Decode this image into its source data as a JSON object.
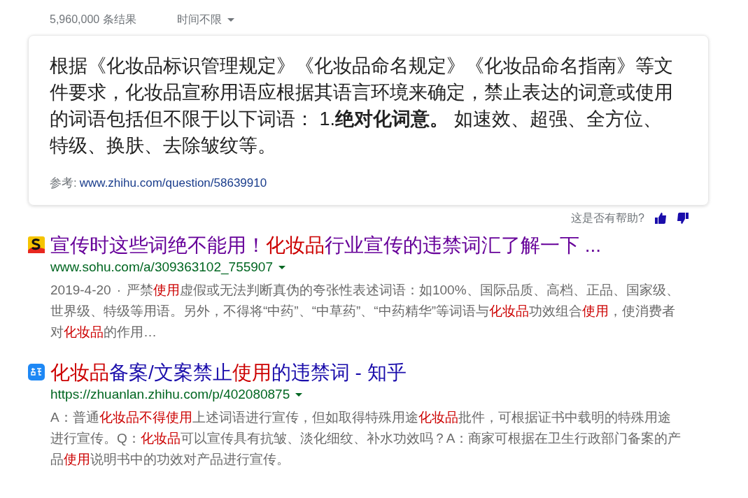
{
  "result_stats": {
    "count": "5,960,000 条结果",
    "time_filter": "时间不限"
  },
  "answer_card": {
    "text": "根据《化妆品标识管理规定》《化妆品命名规定》《化妆品命名指南》等文件要求，化妆品宣称用语应根据其语言环境来确定，禁止表达的词意或使用的词语包括但不限于以下词语： 1.**绝对化词意。** 如速效、超强、全方位、特级、换肤、去除皱纹等。",
    "source_label": "参考:",
    "source_link": "www.zhihu.com/question/58639910"
  },
  "feedback": {
    "question": "这是否有帮助?"
  },
  "results": [
    {
      "kind": "sohu",
      "visited": true,
      "title": [
        {
          "text": "宣传时这些词绝不能用！",
          "highlight": false
        },
        {
          "text": "化妆品",
          "highlight": true
        },
        {
          "text": "行业宣传的违禁词汇了解一下 ...",
          "highlight": false
        }
      ],
      "url": "www.sohu.com/a/309363102_755907",
      "date": "2019-4-20",
      "separator": "·",
      "snippet": [
        {
          "text": "严禁",
          "highlight": false
        },
        {
          "text": "使用",
          "highlight": true
        },
        {
          "text": "虚假或无法判断真伪的夸张性表述词语：如100%、国际品质、高档、正品、国家级、世界级、特级等用语。另外，不得将“中药”、“中草药”、“中药精华”等词语与",
          "highlight": false
        },
        {
          "text": "化妆品",
          "highlight": true
        },
        {
          "text": "功效组合",
          "highlight": false
        },
        {
          "text": "使用",
          "highlight": true
        },
        {
          "text": "，使消费者对",
          "highlight": false
        },
        {
          "text": "化妆品",
          "highlight": true
        },
        {
          "text": "的作用…",
          "highlight": false
        }
      ]
    },
    {
      "kind": "zhihu",
      "visited": false,
      "title": [
        {
          "text": "化妆品",
          "highlight": true
        },
        {
          "text": "备案/文案禁止",
          "highlight": false
        },
        {
          "text": "使用",
          "highlight": true
        },
        {
          "text": "的违禁词 - 知乎",
          "highlight": false
        }
      ],
      "url": "https://zhuanlan.zhihu.com/p/402080875",
      "snippet": [
        {
          "text": "A：普通",
          "highlight": false
        },
        {
          "text": "化妆品不得使用",
          "highlight": true
        },
        {
          "text": "上述词语进行宣传，但如取得特殊用途",
          "highlight": false
        },
        {
          "text": "化妆品",
          "highlight": true
        },
        {
          "text": "批件，可根据证书中载明的特殊用途进行宣传。Q：",
          "highlight": false
        },
        {
          "text": "化妆品",
          "highlight": true
        },
        {
          "text": "可以宣传具有抗皱、淡化细纹、补水功效吗？A：商家可根据在卫生行政部门备案的产品",
          "highlight": false
        },
        {
          "text": "使用",
          "highlight": true
        },
        {
          "text": "说明书中的功效对产品进行宣传。",
          "highlight": false
        }
      ]
    }
  ]
}
